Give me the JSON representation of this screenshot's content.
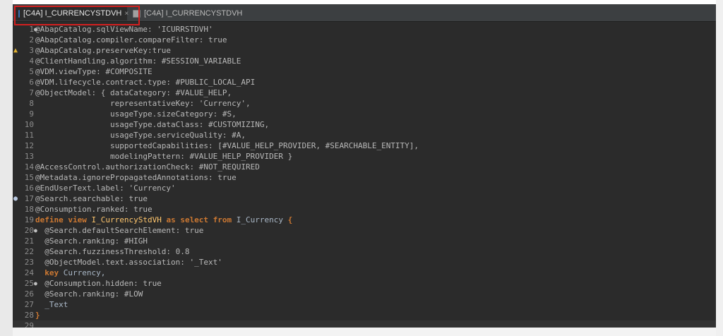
{
  "tabs": [
    {
      "label": "[C4A] I_CURRENCYSTDVH",
      "close": "×",
      "active": true
    },
    {
      "label": "[C4A] I_CURRENCYSTDVH",
      "active": false
    }
  ],
  "code_lines": [
    {
      "num": "1",
      "text": "@AbapCatalog.sqlViewName: 'ICURRSTDVH'",
      "marker": "",
      "fold": "●"
    },
    {
      "num": "2",
      "text": "@AbapCatalog.compiler.compareFilter: true",
      "marker": "",
      "fold": ""
    },
    {
      "num": "3",
      "text": "@AbapCatalog.preserveKey:true",
      "marker": "warning",
      "fold": ""
    },
    {
      "num": "4",
      "text": "@ClientHandling.algorithm: #SESSION_VARIABLE",
      "marker": "",
      "fold": ""
    },
    {
      "num": "5",
      "text": "@VDM.viewType: #COMPOSITE",
      "marker": "",
      "fold": ""
    },
    {
      "num": "6",
      "text": "@VDM.lifecycle.contract.type: #PUBLIC_LOCAL_API",
      "marker": "",
      "fold": ""
    },
    {
      "num": "7",
      "text": "@ObjectModel: { dataCategory: #VALUE_HELP,",
      "marker": "",
      "fold": ""
    },
    {
      "num": "8",
      "text": "                representativeKey: 'Currency',",
      "marker": "",
      "fold": ""
    },
    {
      "num": "9",
      "text": "                usageType.sizeCategory: #S,",
      "marker": "",
      "fold": ""
    },
    {
      "num": "10",
      "text": "                usageType.dataClass: #CUSTOMIZING,",
      "marker": "",
      "fold": ""
    },
    {
      "num": "11",
      "text": "                usageType.serviceQuality: #A,",
      "marker": "",
      "fold": ""
    },
    {
      "num": "12",
      "text": "                supportedCapabilities: [#VALUE_HELP_PROVIDER, #SEARCHABLE_ENTITY],",
      "marker": "",
      "fold": ""
    },
    {
      "num": "13",
      "text": "                modelingPattern: #VALUE_HELP_PROVIDER }",
      "marker": "",
      "fold": ""
    },
    {
      "num": "14",
      "text": "@AccessControl.authorizationCheck: #NOT_REQUIRED",
      "marker": "",
      "fold": ""
    },
    {
      "num": "15",
      "text": "@Metadata.ignorePropagatedAnnotations: true",
      "marker": "",
      "fold": ""
    },
    {
      "num": "16",
      "text": "@EndUserText.label: 'Currency'",
      "marker": "",
      "fold": ""
    },
    {
      "num": "17",
      "text": "@Search.searchable: true",
      "marker": "bullet",
      "fold": ""
    },
    {
      "num": "18",
      "text": "@Consumption.ranked: true",
      "marker": "",
      "fold": ""
    },
    {
      "num": "19",
      "text": "define view I_CurrencyStdVH as select from I_Currency {",
      "marker": "",
      "fold": "",
      "style": "define"
    },
    {
      "num": "20",
      "text": "  @Search.defaultSearchElement: true",
      "marker": "",
      "fold": "●"
    },
    {
      "num": "21",
      "text": "  @Search.ranking: #HIGH",
      "marker": "",
      "fold": ""
    },
    {
      "num": "22",
      "text": "  @Search.fuzzinessThreshold: 0.8",
      "marker": "",
      "fold": ""
    },
    {
      "num": "23",
      "text": "  @ObjectModel.text.association: '_Text'",
      "marker": "",
      "fold": ""
    },
    {
      "num": "24",
      "text": "  key Currency,",
      "marker": "",
      "fold": "",
      "style": "key"
    },
    {
      "num": "25",
      "text": "  @Consumption.hidden: true",
      "marker": "",
      "fold": "●"
    },
    {
      "num": "26",
      "text": "  @Search.ranking: #LOW",
      "marker": "",
      "fold": ""
    },
    {
      "num": "27",
      "text": "  _Text",
      "marker": "",
      "fold": "",
      "style": "plain"
    },
    {
      "num": "28",
      "text": "}",
      "marker": "",
      "fold": "",
      "style": "brace"
    },
    {
      "num": "29",
      "text": "",
      "marker": "",
      "fold": "",
      "current": true
    }
  ],
  "colors": {
    "keyword": "#cc7832",
    "view_name": "#ffc66d",
    "annotation": "#b8b8b8",
    "background": "#2b2b2b",
    "highlight_box": "#d32020"
  }
}
